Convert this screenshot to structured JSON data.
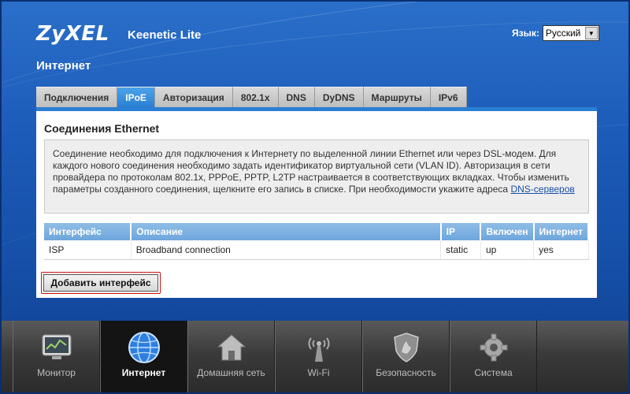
{
  "header": {
    "logo": "ZyXEL",
    "model": "Keenetic Lite",
    "language_label": "Язык:",
    "language_value": "Русский",
    "section_title": "Интернет"
  },
  "tabs": [
    {
      "label": "Подключения",
      "active": false
    },
    {
      "label": "IPoE",
      "active": true
    },
    {
      "label": "Авторизация",
      "active": false
    },
    {
      "label": "802.1x",
      "active": false
    },
    {
      "label": "DNS",
      "active": false
    },
    {
      "label": "DyDNS",
      "active": false
    },
    {
      "label": "Маршруты",
      "active": false
    },
    {
      "label": "IPv6",
      "active": false
    }
  ],
  "panel": {
    "title": "Соединения Ethernet",
    "info_text": "Соединение необходимо для подключения к Интернету по выделенной линии Ethernet или через DSL-модем. Для каждого нового соединения необходимо задать идентификатор виртуальной сети (VLAN ID). Авторизация в сети провайдера по протоколам 802.1x, PPPoE, PPTP, L2TP настраивается в соответствующих вкладках. Чтобы изменить параметры созданного соединения, щелкните его запись в списке. При необходимости укажите адреса ",
    "info_link": "DNS-серверов",
    "table": {
      "headers": [
        "Интерфейс",
        "Описание",
        "IP",
        "Включен",
        "Интернет"
      ],
      "rows": [
        [
          "ISP",
          "Broadband connection",
          "static",
          "up",
          "yes"
        ]
      ]
    },
    "add_button": "Добавить интерфейс"
  },
  "dock": [
    {
      "label": "Монитор",
      "icon": "monitor-icon",
      "active": false
    },
    {
      "label": "Интернет",
      "icon": "globe-icon",
      "active": true
    },
    {
      "label": "Домашняя сеть",
      "icon": "home-icon",
      "active": false
    },
    {
      "label": "Wi-Fi",
      "icon": "wifi-antenna-icon",
      "active": false
    },
    {
      "label": "Безопасность",
      "icon": "shield-icon",
      "active": false
    },
    {
      "label": "Система",
      "icon": "gear-icon",
      "active": false
    }
  ],
  "colors": {
    "background": "#1c5bb8",
    "tab_active": "#2a7fd3",
    "table_header": "#6ea6dc",
    "dock": "#3a3a3a",
    "button_highlight": "#d01010"
  }
}
